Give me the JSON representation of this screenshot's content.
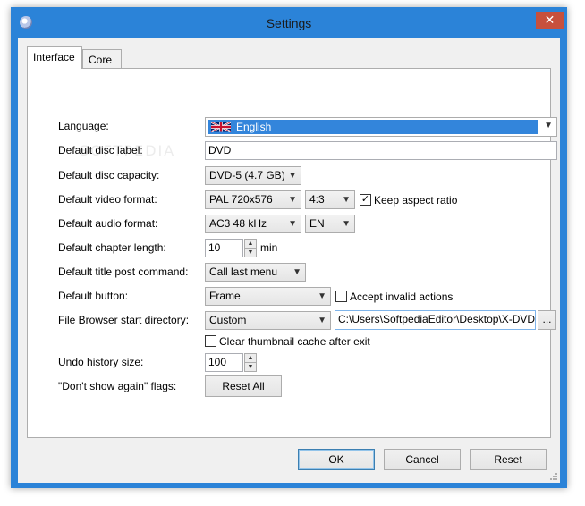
{
  "window": {
    "title": "Settings",
    "close_glyph": "✕"
  },
  "tabs": [
    {
      "label": "Interface",
      "active": true
    },
    {
      "label": "Core",
      "active": false
    }
  ],
  "form": {
    "language": {
      "label": "Language:",
      "value": "English",
      "flag_icon": "uk-flag-icon"
    },
    "disc_label": {
      "label": "Default disc label:",
      "value": "DVD"
    },
    "disc_capacity": {
      "label": "Default disc capacity:",
      "value": "DVD-5 (4.7 GB)"
    },
    "video_format": {
      "label": "Default video format:",
      "value": "PAL 720x576",
      "aspect": "4:3",
      "keep_aspect_label": "Keep aspect ratio",
      "keep_aspect_checked": true
    },
    "audio_format": {
      "label": "Default audio format:",
      "value": "AC3 48 kHz",
      "language": "EN"
    },
    "chapter_length": {
      "label": "Default chapter length:",
      "value": "10",
      "unit": "min"
    },
    "title_post_command": {
      "label": "Default title post command:",
      "value": "Call last menu"
    },
    "default_button": {
      "label": "Default button:",
      "value": "Frame",
      "accept_invalid_label": "Accept invalid actions",
      "accept_invalid_checked": false
    },
    "file_browser_dir": {
      "label": "File Browser start directory:",
      "value": "Custom",
      "path": "C:\\Users\\SoftpediaEditor\\Desktop\\X-DVD",
      "browse_label": "..."
    },
    "clear_thumbnail": {
      "label": "Clear thumbnail cache after exit",
      "checked": false
    },
    "undo_history": {
      "label": "Undo history size:",
      "value": "100"
    },
    "dont_show_again": {
      "label": "\"Don't show again\" flags:",
      "button": "Reset All"
    }
  },
  "buttons": {
    "ok": "OK",
    "cancel": "Cancel",
    "reset": "Reset"
  },
  "watermark": "SOFTPEDIA",
  "colors": {
    "accent": "#2b83d8",
    "close": "#c7503d",
    "selection": "#3385db"
  }
}
